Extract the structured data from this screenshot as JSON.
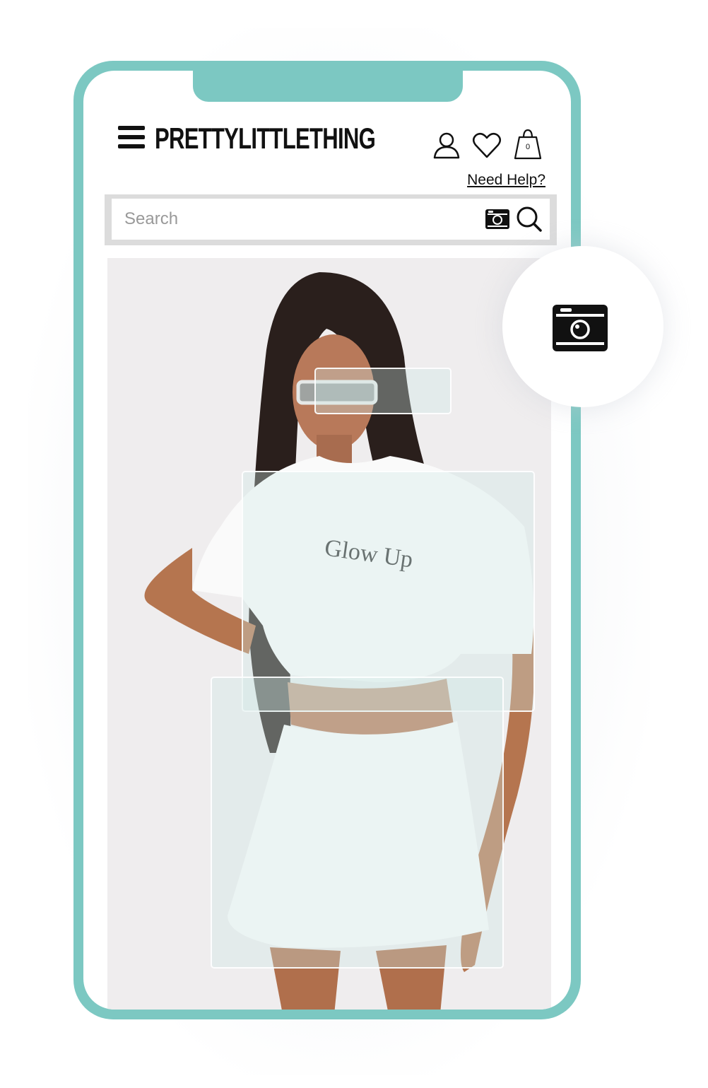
{
  "app": {
    "brand": "PRETTYLITTLETHING",
    "accent_color": "#7cc8c2"
  },
  "header": {
    "menu_icon": "hamburger-menu-icon",
    "icons": [
      {
        "name": "account-icon",
        "label": "Account"
      },
      {
        "name": "wishlist-heart-icon",
        "label": "Wishlist"
      },
      {
        "name": "shopping-bag-icon",
        "label": "Bag"
      }
    ],
    "bag_count": "0",
    "need_help": "Need Help?"
  },
  "search": {
    "placeholder": "Search",
    "value": "",
    "camera_icon": "camera-icon",
    "submit_icon": "search-icon"
  },
  "visual_search": {
    "badge_icon": "camera-icon",
    "image_text": "Glow Up",
    "detections": [
      {
        "label": "sunglasses"
      },
      {
        "label": "t-shirt"
      },
      {
        "label": "skirt"
      }
    ]
  }
}
